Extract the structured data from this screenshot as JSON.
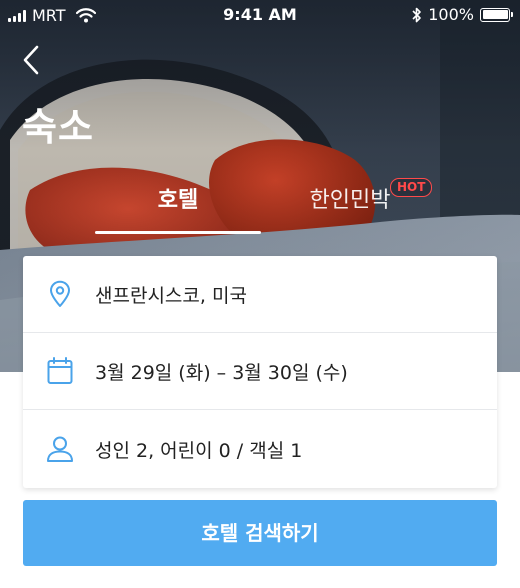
{
  "status_bar": {
    "carrier": "MRT",
    "time": "9:41 AM",
    "battery": "100%"
  },
  "header": {
    "title": "숙소"
  },
  "tabs": [
    {
      "label": "호텔",
      "selected": true
    },
    {
      "label": "한인민박",
      "badge": "HOT",
      "selected": false
    }
  ],
  "search_form": {
    "destination": "샌프란시스코, 미국",
    "dates": "3월 29일 (화) – 3월 30일 (수)",
    "guests": "성인 2, 어린이 0 / 객실 1"
  },
  "search_button": {
    "label": "호텔 검색하기"
  },
  "colors": {
    "accent": "#51abf1",
    "icon": "#4aa3ea",
    "hot_badge": "#ff4a4a",
    "pillow": "#b8321f"
  },
  "icons": {
    "back": "chevron-left-icon",
    "destination": "location-pin-icon",
    "dates": "calendar-icon",
    "guests": "person-icon"
  }
}
